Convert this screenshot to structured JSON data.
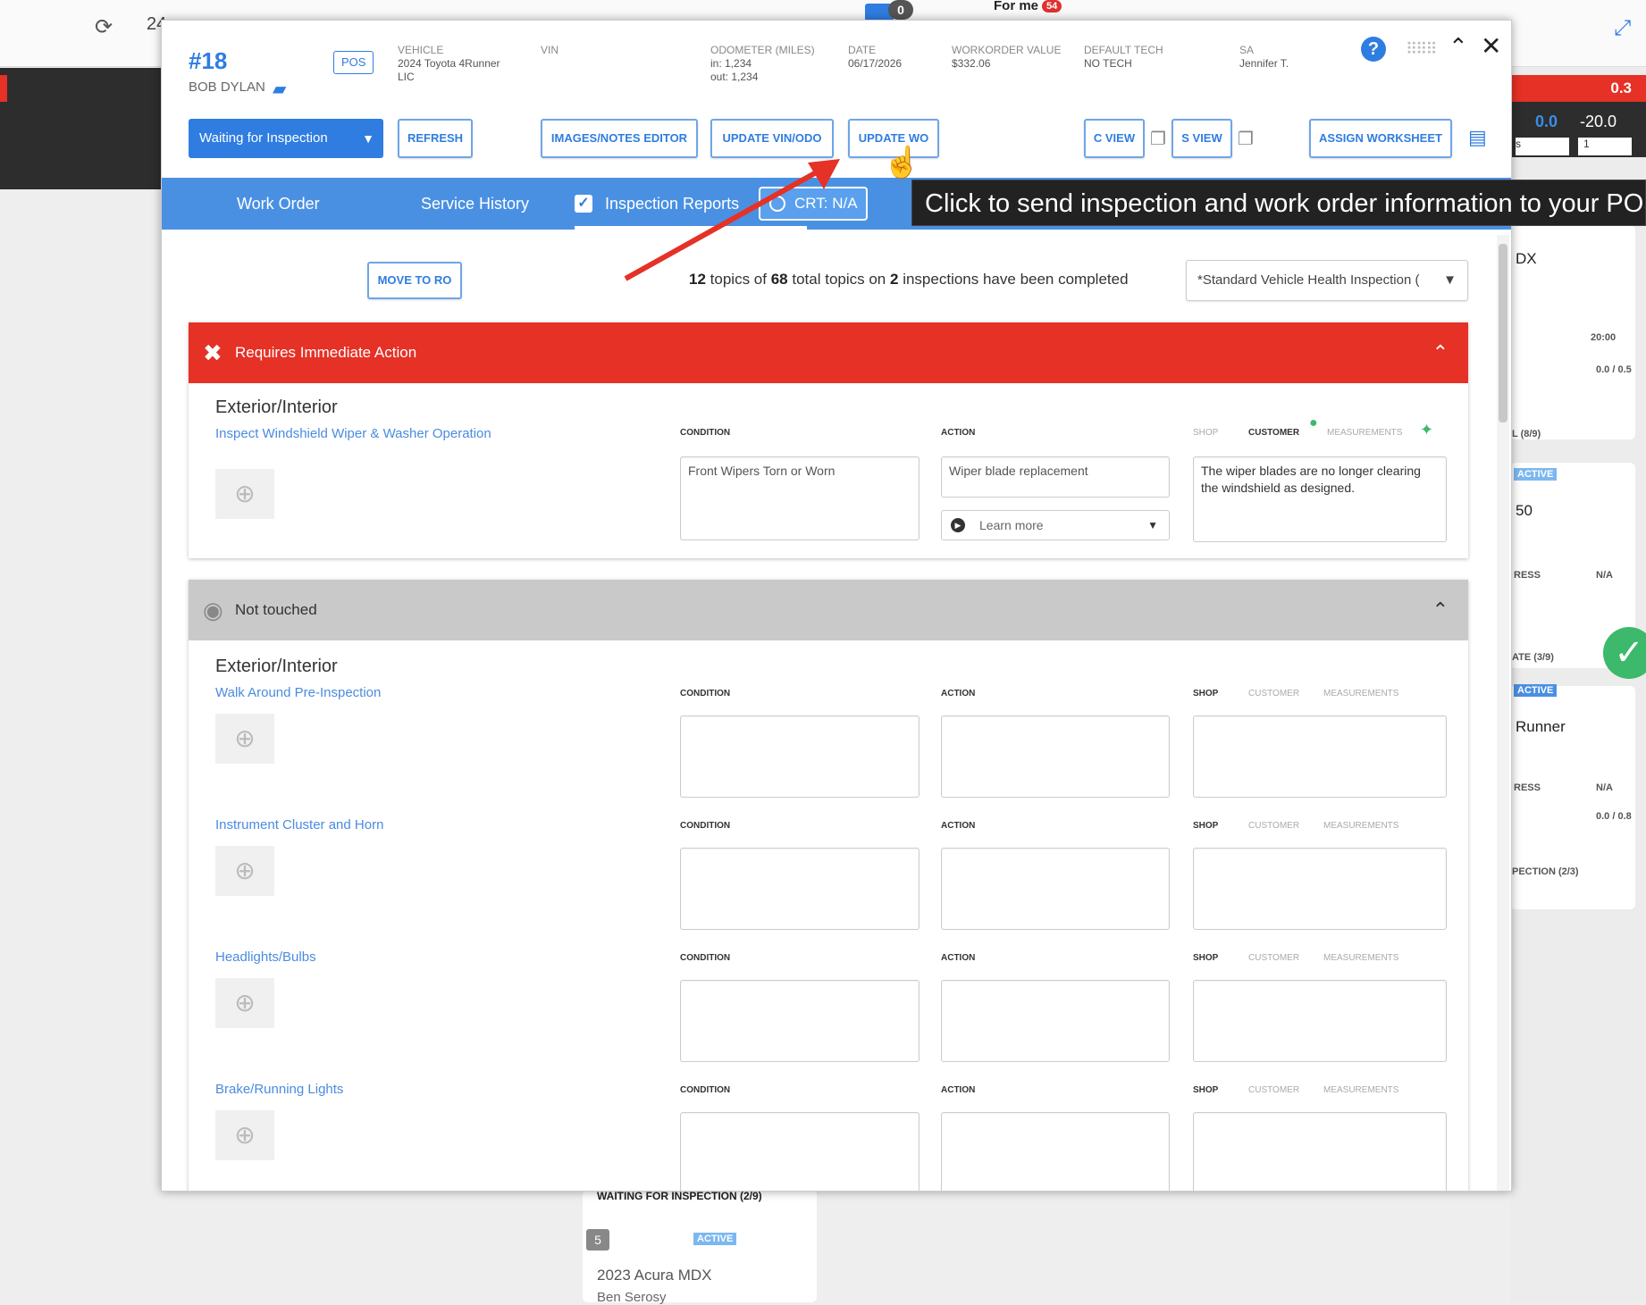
{
  "background": {
    "topbar_num": "24",
    "zero_badge": "0",
    "for_me": "For me",
    "for_me_count": "54",
    "right_panel": {
      "red_value": "0.3",
      "val_a": "0.0",
      "val_b": "-20.0",
      "sel_a": "s",
      "sel_b": "1",
      "cards": [
        {
          "title": "DX",
          "stat": "20:00",
          "prog": "0.0 / 0.5",
          "label": "L (8/9)"
        },
        {
          "title": "50",
          "stat": "N/A",
          "label": "ATE (3/9)"
        },
        {
          "title": "Runner",
          "stat": "N/A",
          "prog": "0.0 / 0.8",
          "label": "PECTION (2/3)"
        }
      ],
      "tag_active": "ACTIVE",
      "progress_label": "RESS"
    },
    "bottom_card": {
      "label": "WAITING FOR INSPECTION (2/9)",
      "badge": "5",
      "tag_active": "ACTIVE",
      "title": "2023 Acura MDX",
      "sub": "Ben Serosy"
    }
  },
  "header": {
    "ro_number": "#18",
    "customer": "BOB DYLAN",
    "pos_label": "POS",
    "vehicle_label": "VEHICLE",
    "vehicle_value": "2024 Toyota 4Runner",
    "vehicle_value2": "LIC",
    "vin_label": "VIN",
    "odometer_label": "ODOMETER (MILES)",
    "odometer_in": "in: 1,234",
    "odometer_out": "out: 1,234",
    "date_label": "DATE",
    "date_value": "06/17/2026",
    "wo_value_label": "WORKORDER VALUE",
    "wo_value": "$332.06",
    "tech_label": "DEFAULT TECH",
    "tech_value": "NO TECH",
    "sa_label": "SA",
    "sa_value": "Jennifer T."
  },
  "toolbar": {
    "status": "Waiting for Inspection",
    "refresh": "REFRESH",
    "images_notes": "IMAGES/NOTES EDITOR",
    "update_vin": "UPDATE VIN/ODO",
    "update_wo": "UPDATE WO",
    "c_view": "C VIEW",
    "s_view": "S VIEW",
    "assign_worksheet": "ASSIGN WORKSHEET"
  },
  "tabs": {
    "work_order": "Work Order",
    "service_history": "Service History",
    "inspection_reports": "Inspection Reports",
    "crt": "CRT: N/A"
  },
  "tooltip": "Click to send inspection and work order information to your POS",
  "inspection": {
    "move_to_ro": "MOVE TO RO",
    "done_topics": "12",
    "total_topics": "68",
    "inspections": "2",
    "summary_a": "topics of",
    "summary_b": "total topics on",
    "summary_c": "inspections have been completed",
    "selected": "*Standard Vehicle Health Inspection (",
    "labels": {
      "condition": "CONDITION",
      "action": "ACTION",
      "shop": "SHOP",
      "customer": "CUSTOMER",
      "measurements": "MEASUREMENTS"
    },
    "sections": [
      {
        "title": "Requires Immediate Action",
        "group": "Exterior/Interior",
        "items": [
          {
            "name": "Inspect Windshield Wiper & Washer Operation",
            "condition": "Front Wipers Torn or Worn",
            "action": "Wiper blade replacement",
            "learn_more": "Learn more",
            "note": "The wiper blades are no longer clearing the windshield as designed."
          }
        ]
      },
      {
        "title": "Not touched",
        "group": "Exterior/Interior",
        "items": [
          {
            "name": "Walk Around Pre-Inspection"
          },
          {
            "name": "Instrument Cluster and Horn"
          },
          {
            "name": "Headlights/Bulbs"
          },
          {
            "name": "Brake/Running Lights"
          }
        ]
      }
    ]
  },
  "colors": {
    "accent": "#2f7de1",
    "tab_bar": "#4a90e2",
    "urgent": "#e53126",
    "not_touched": "#c9c9c9"
  }
}
